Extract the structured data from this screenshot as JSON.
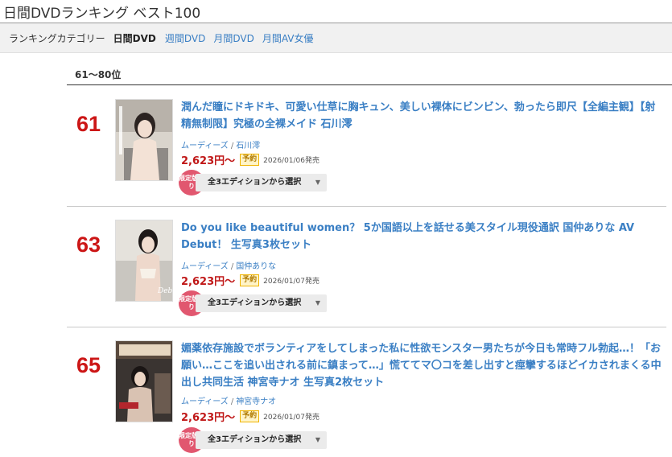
{
  "page_title": "日間DVDランキング ベスト100",
  "category_bar": {
    "label": "ランキングカテゴリー",
    "current": "日間DVD",
    "links": [
      "週間DVD",
      "月間DVD",
      "月間AV女優"
    ]
  },
  "range_heading": "61〜80位",
  "items": [
    {
      "rank": "61",
      "title": "潤んだ瞳にドキドキ、可愛い仕草に胸キュン、美しい裸体にビンビン、勃ったら即尺【全編主観】【射精無制限】究極の全裸メイド 石川澪",
      "maker": "ムーディーズ",
      "actress": "石川澪",
      "price": "2,623円〜",
      "status": "予約",
      "date": "2026/01/06発売",
      "limited": "限定版あり",
      "edition_select": "全3エディションから選択"
    },
    {
      "rank": "63",
      "title": "Do you like beautiful women？ 5か国語以上を話せる美スタイル現役通訳 国仲ありな AV Debut！ 生写真3枚セット",
      "maker": "ムーディーズ",
      "actress": "国仲ありな",
      "price": "2,623円〜",
      "status": "予約",
      "date": "2026/01/07発売",
      "limited": "限定版あり",
      "edition_select": "全3エディションから選択"
    },
    {
      "rank": "65",
      "title": "媚薬依存施設でボランティアをしてしまった私に性欲モンスター男たちが今日も常時フル勃起…！「お願い…ここを追い出される前に鎮まって…」慌ててマ〇コを差し出すと痙攣するほどイカされまくる中出し共同生活 神宮寺ナオ 生写真2枚セット",
      "maker": "ムーディーズ",
      "actress": "神宮寺ナオ",
      "price": "2,623円〜",
      "status": "予約",
      "date": "2026/01/07発売",
      "limited": "限定版あり",
      "edition_select": "全3エディションから選択"
    }
  ],
  "colors": {
    "rank": "#cc1616",
    "link": "#3a7fc4",
    "price": "#c01818",
    "limited_badge": "#e1576f"
  },
  "icons": {
    "dropdown": "caret-down-icon"
  }
}
